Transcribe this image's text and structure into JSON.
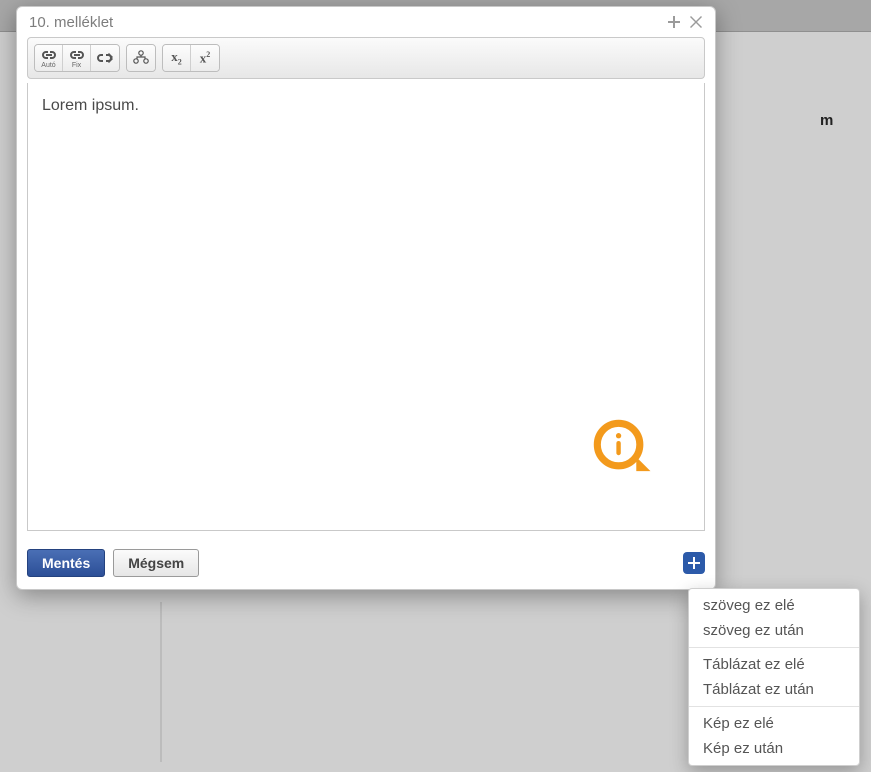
{
  "modal": {
    "title": "10. melléklet",
    "header_plus_tooltip": "add",
    "header_close_tooltip": "close"
  },
  "toolbar": {
    "link_auto": {
      "label": "Autó"
    },
    "link_fix": {
      "label": "Fix"
    },
    "link_remove": {
      "label": ""
    },
    "tree": {
      "label": ""
    },
    "subscript": {
      "label": "x",
      "sub": "2"
    },
    "superscript": {
      "label": "x",
      "sup": "2"
    }
  },
  "editor": {
    "content": "Lorem ipsum."
  },
  "footer": {
    "save": "Mentés",
    "cancel": "Mégsem",
    "add_tooltip": "+"
  },
  "menu": {
    "items": [
      "szöveg ez elé",
      "szöveg ez után",
      "Táblázat ez elé",
      "Táblázat ez után",
      "Kép ez elé",
      "Kép ez után"
    ]
  },
  "background": {
    "trailing_text": "m"
  },
  "colors": {
    "primary": "#2c5aa9",
    "callout": "#f39a1c"
  }
}
